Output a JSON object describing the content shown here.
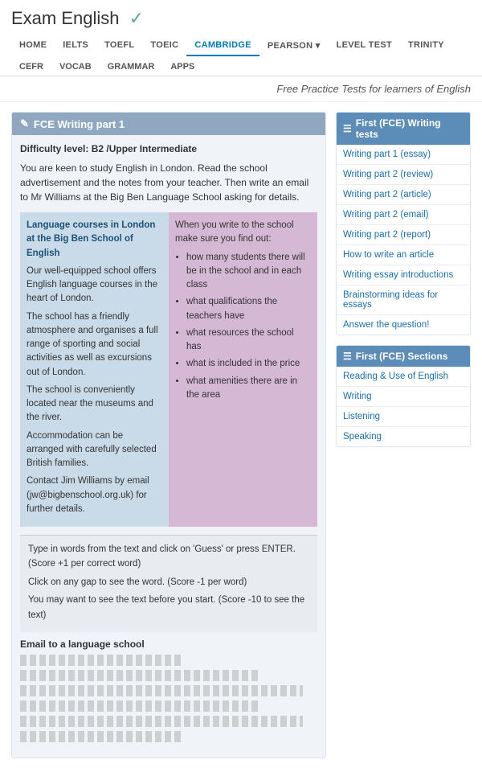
{
  "header": {
    "title": "Exam English",
    "checkmark": "✓",
    "subtitle": "Free Practice Tests for learners of English"
  },
  "nav_primary": [
    {
      "label": "HOME",
      "active": false
    },
    {
      "label": "IELTS",
      "active": false
    },
    {
      "label": "TOEFL",
      "active": false
    },
    {
      "label": "TOEIC",
      "active": false
    },
    {
      "label": "CAMBRIDGE",
      "active": true
    },
    {
      "label": "PEARSON ▾",
      "active": false
    },
    {
      "label": "LEVEL TEST",
      "active": false
    },
    {
      "label": "TRINITY",
      "active": false
    }
  ],
  "nav_secondary": [
    {
      "label": "CEFR"
    },
    {
      "label": "VOCAB"
    },
    {
      "label": "GRAMMAR"
    },
    {
      "label": "APPS"
    }
  ],
  "fce_panel": {
    "header": "FCE Writing part 1",
    "difficulty_label": "Difficulty level:",
    "difficulty_value": "B2 /Upper Intermediate",
    "intro": "You are keen to study English in London. Read the school advertisement and the notes from your teacher. Then write an email to Mr Williams at the Big Ben Language School asking for details.",
    "col_left_heading": "Language courses in London at the Big Ben School of English",
    "col_left_paragraphs": [
      "Our well-equipped school offers English language courses in the heart of London.",
      "The school has a friendly atmosphere and organises a full range of sporting and social activities as well as excursions out of London.",
      "The school is conveniently located near the museums and the river.",
      "Accommodation can be arranged with carefully selected British families.",
      "Contact Jim Williams by email (jw@bigbenschool.org.uk) for further details."
    ],
    "col_right_heading": "When you write to the school make sure you find out:",
    "col_right_items": [
      "how many students there will be in the school and in each class",
      "what qualifications the teachers have",
      "what resources the school has",
      "what is included in the price",
      "what amenities there are in the area"
    ],
    "instructions": [
      "Type in words from the text and click on 'Guess' or press ENTER. (Score +1 per correct word)",
      "Click on any gap to see the word. (Score -1 per word)",
      "You may want to see the text before you start. (Score -10 to see the text)"
    ],
    "email_title": "Email to a language school"
  },
  "sidebar_writing": {
    "header": "First (FCE) Writing tests",
    "links": [
      "Writing part 1 (essay)",
      "Writing part 2 (review)",
      "Writing part 2 (article)",
      "Writing part 2 (email)",
      "Writing part 2 (report)",
      "How to write an article",
      "Writing essay introductions",
      "Brainstorming ideas for essays",
      "Answer the question!"
    ]
  },
  "sidebar_sections": {
    "header": "First (FCE) Sections",
    "links": [
      "Reading & Use of English",
      "Writing",
      "Listening",
      "Speaking"
    ]
  }
}
